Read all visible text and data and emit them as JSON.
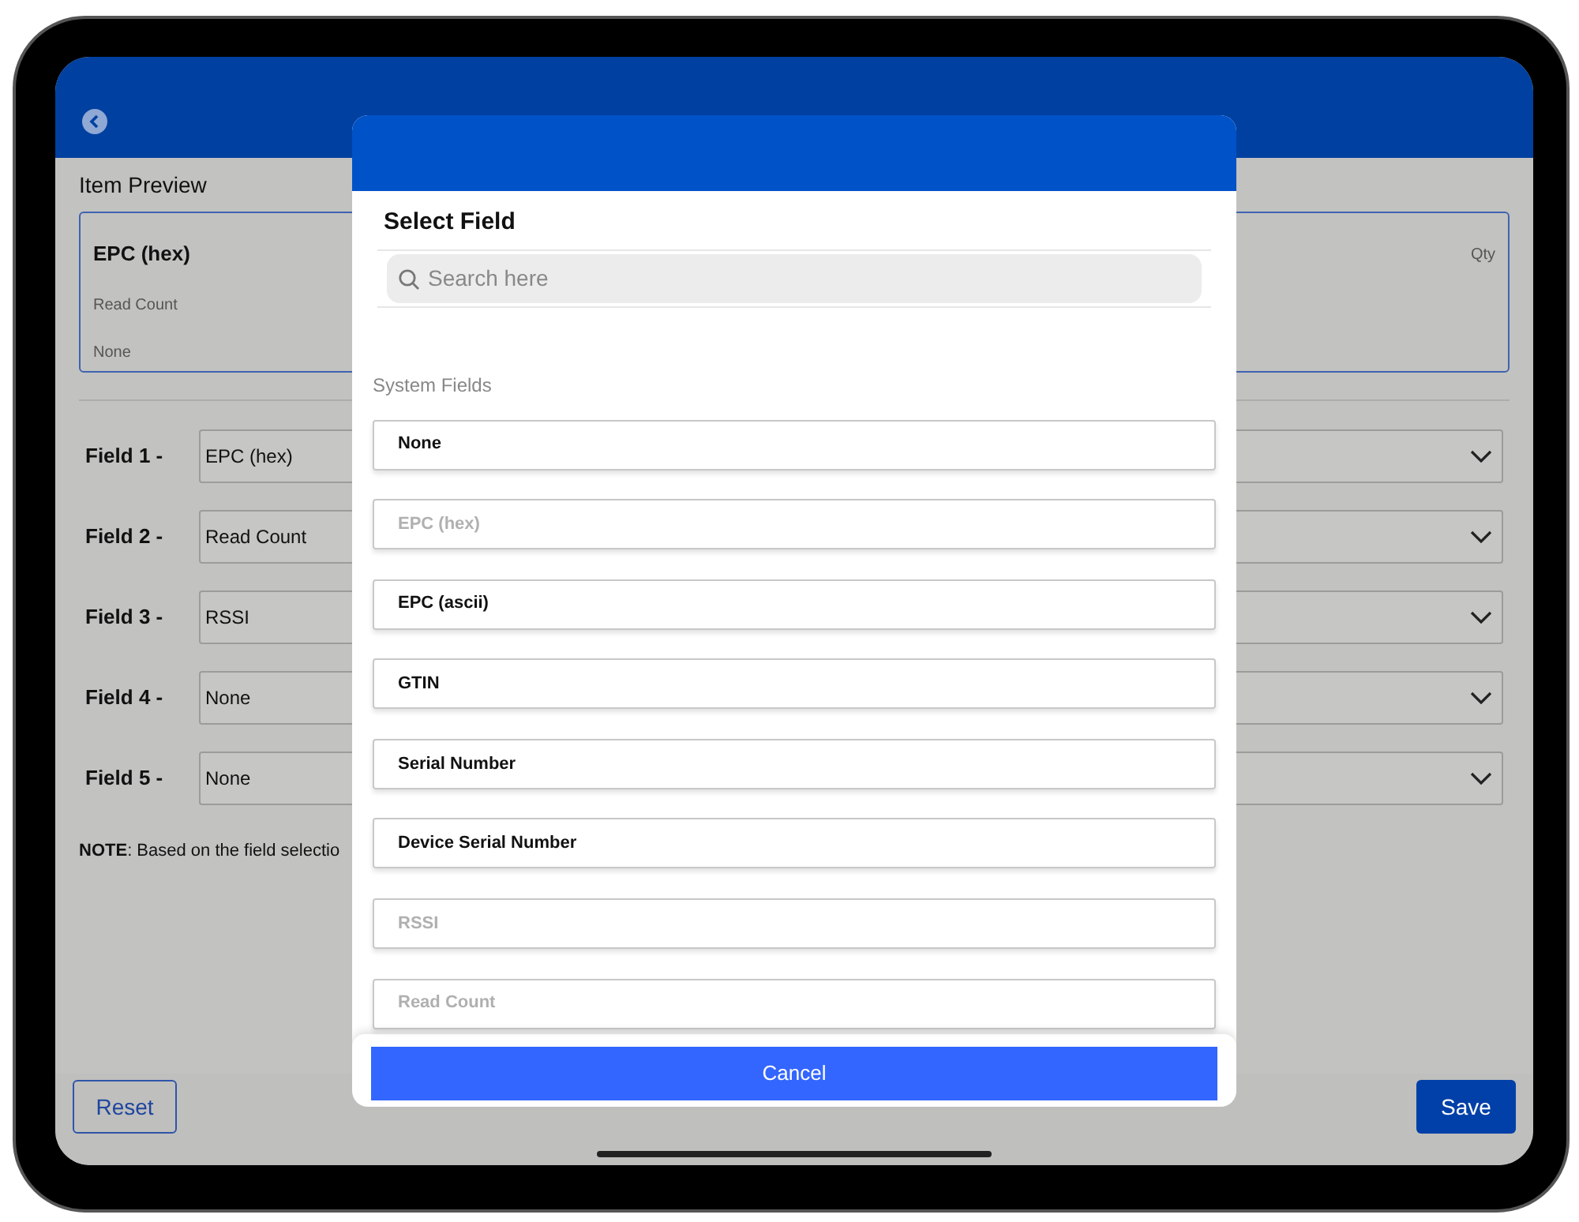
{
  "preview": {
    "title": "Item Preview",
    "primary": "EPC (hex)",
    "secondary": "Read Count",
    "tertiary": "None",
    "qty": "Qty"
  },
  "fields": [
    {
      "label": "Field 1 -",
      "value": "EPC (hex)"
    },
    {
      "label": "Field 2 -",
      "value": "Read Count"
    },
    {
      "label": "Field 3 -",
      "value": "RSSI"
    },
    {
      "label": "Field 4 -",
      "value": "None"
    },
    {
      "label": "Field 5 -",
      "value": "None"
    }
  ],
  "note": "**NOTE**: Based on the field selectio",
  "footer": {
    "reset": "Reset",
    "save": "Save"
  },
  "dialog": {
    "title": "Select Field",
    "search": {
      "placeholder": "Search here"
    },
    "section": "System Fields",
    "options": [
      {
        "label": "None",
        "disabled": false
      },
      {
        "label": "EPC (hex)",
        "disabled": true
      },
      {
        "label": "EPC (ascii)",
        "disabled": false
      },
      {
        "label": "GTIN",
        "disabled": false
      },
      {
        "label": "Serial Number",
        "disabled": false
      },
      {
        "label": "Device Serial Number",
        "disabled": false
      },
      {
        "label": "RSSI",
        "disabled": true
      },
      {
        "label": "Read Count",
        "disabled": true
      }
    ],
    "cancel": "Cancel"
  }
}
